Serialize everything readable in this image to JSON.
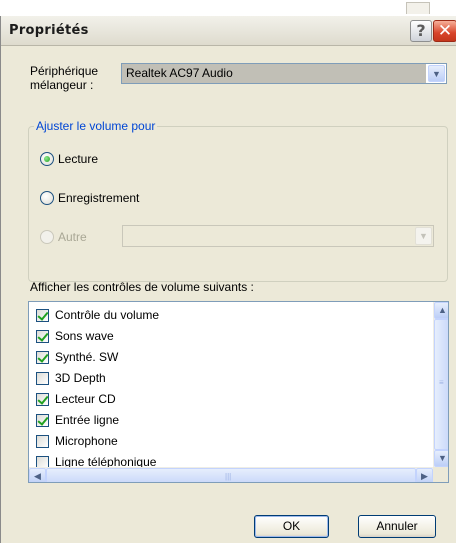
{
  "window": {
    "title": "Propriétés",
    "help_glyph": "?",
    "close_glyph": "✕"
  },
  "mixer": {
    "label": "Périphérique mélangeur :",
    "device_value": "Realtek AC97 Audio",
    "arrow_glyph": "▼"
  },
  "adjust_group": {
    "legend": "Ajuster le volume pour",
    "options": [
      {
        "label": "Lecture",
        "checked": true,
        "enabled": true
      },
      {
        "label": "Enregistrement",
        "checked": false,
        "enabled": true
      },
      {
        "label": "Autre",
        "checked": false,
        "enabled": false
      }
    ],
    "other_combo_value": ""
  },
  "controls_list": {
    "heading": "Afficher les contrôles de volume suivants :",
    "items": [
      {
        "label": "Contrôle du volume",
        "checked": true
      },
      {
        "label": "Sons wave",
        "checked": true
      },
      {
        "label": "Synthé. SW",
        "checked": true
      },
      {
        "label": "3D Depth",
        "checked": false
      },
      {
        "label": "Lecteur CD",
        "checked": true
      },
      {
        "label": "Entrée ligne",
        "checked": true
      },
      {
        "label": "Microphone",
        "checked": false
      },
      {
        "label": "Ligne téléphonique",
        "checked": false
      }
    ],
    "scroll_up_glyph": "▲",
    "scroll_down_glyph": "▼",
    "scroll_left_glyph": "◀",
    "scroll_right_glyph": "▶",
    "grip_glyph": "≡",
    "hgrip_glyph": "|||"
  },
  "buttons": {
    "ok": "OK",
    "cancel": "Annuler"
  }
}
